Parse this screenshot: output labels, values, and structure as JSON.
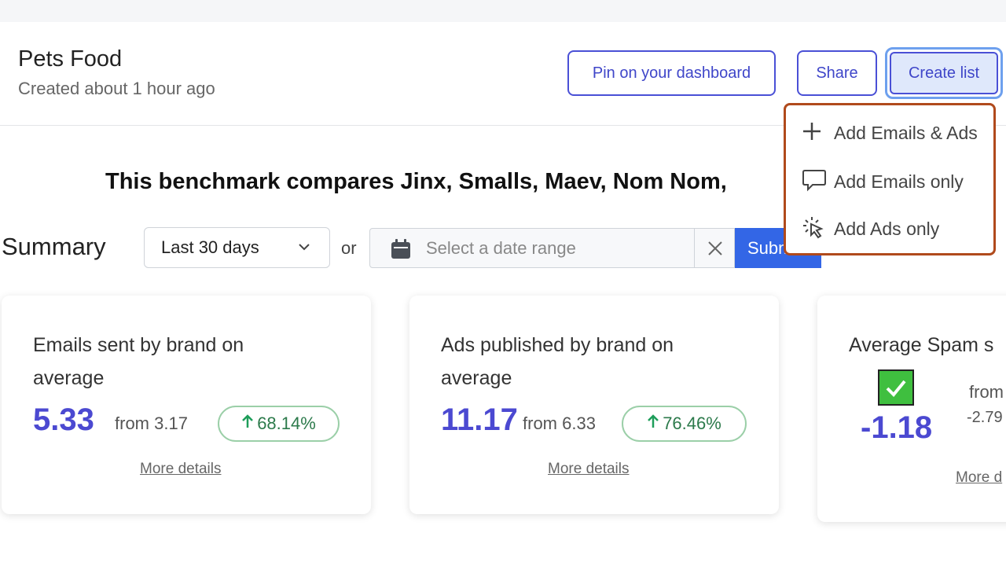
{
  "header": {
    "title": "Pets Food",
    "subtitle": "Created about 1 hour ago",
    "pin_label": "Pin on your dashboard",
    "share_label": "Share",
    "create_label": "Create list"
  },
  "dropdown": {
    "items": [
      {
        "label": "Add Emails & Ads",
        "icon": "plus-icon"
      },
      {
        "label": "Add Emails only",
        "icon": "speech-bubble-icon"
      },
      {
        "label": "Add Ads only",
        "icon": "click-cursor-icon"
      }
    ]
  },
  "headline": "This benchmark compares Jinx, Smalls, Maev, Nom Nom,",
  "summary": {
    "label": "Summary",
    "period_select": "Last 30 days",
    "or_text": "or",
    "date_placeholder": "Select a date range",
    "submit_label": "Subm"
  },
  "cards": [
    {
      "title": "Emails sent by brand on average",
      "value": "5.33",
      "from": "from 3.17",
      "change": "68.14%",
      "more": "More details"
    },
    {
      "title": "Ads published by brand on average",
      "value": "11.17",
      "from": "from 6.33",
      "change": "76.46%",
      "more": "More details"
    },
    {
      "title": "Average Spam s",
      "value": "-1.18",
      "from": "from",
      "from_value": "-2.79",
      "more": "More d"
    }
  ],
  "colors": {
    "accent": "#4a50d6",
    "value": "#4b49d1",
    "positive": "#2c7a4b",
    "submit": "#3366e6",
    "dropdown_border": "#b04a1c"
  }
}
